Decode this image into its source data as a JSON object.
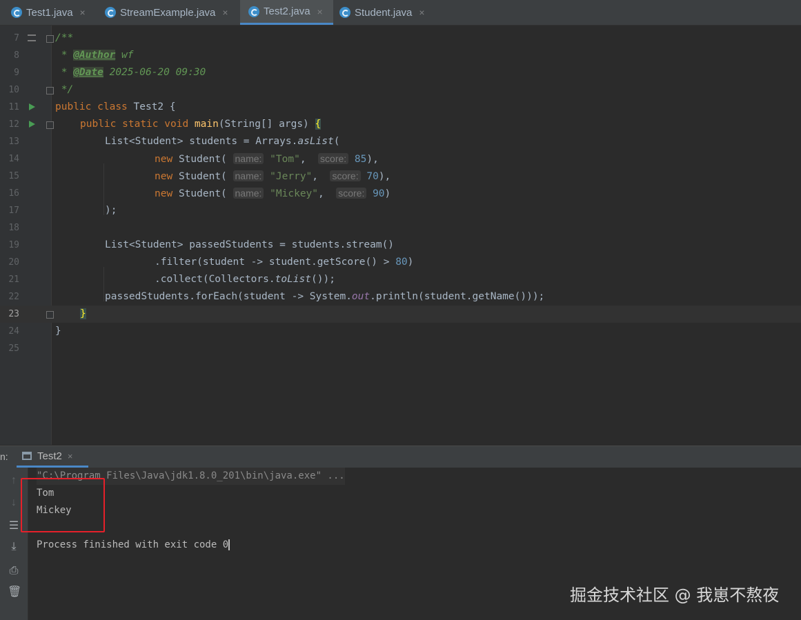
{
  "tabs": [
    {
      "label": "Test1.java",
      "close": "×",
      "active": false
    },
    {
      "label": "StreamExample.java",
      "close": "×",
      "active": false
    },
    {
      "label": "Test2.java",
      "close": "×",
      "active": true
    },
    {
      "label": "Student.java",
      "close": "×",
      "active": false
    }
  ],
  "editor": {
    "line_numbers": [
      "7",
      "8",
      "9",
      "10",
      "11",
      "12",
      "13",
      "14",
      "15",
      "16",
      "17",
      "18",
      "19",
      "20",
      "21",
      "22",
      "23",
      "24",
      "25"
    ],
    "code": {
      "l7": "/**",
      "l8_star": " * ",
      "l8_tag": "@Author",
      "l8_val": " wf",
      "l9_star": " * ",
      "l9_tag": "@Date",
      "l9_val": " 2025-06-20 09:30",
      "l10": " */",
      "kw_public": "public",
      "kw_class": "class",
      "kw_static": "static",
      "kw_void": "void",
      "kw_new": "new",
      "class_name": "Test2",
      "open_brace": "{",
      "close_brace": "}",
      "main": "main",
      "main_args": "(String[] args) ",
      "l13_a": "List<Student> students = Arrays.",
      "as_list": "asList",
      "l13_b": "(",
      "student_ctor": "Student(",
      "hint_name": "name:",
      "hint_score": "score:",
      "students": [
        {
          "name": "\"Tom\"",
          "score": "85",
          "tail": "),"
        },
        {
          "name": "\"Jerry\"",
          "score": "70",
          "tail": "),"
        },
        {
          "name": "\"Mickey\"",
          "score": "90",
          "tail": ")"
        }
      ],
      "comma": ",",
      "l17": ");",
      "l19": "List<Student> passedStudents = students.stream()",
      "l20_a": ".filter(student -> student.getScore() > ",
      "l20_num": "80",
      "l20_b": ")",
      "l21_a": ".collect(Collectors.",
      "to_list": "toList",
      "l21_b": "());",
      "l22_a": "passedStudents.forEach(student -> System.",
      "out": "out",
      "l22_b": ".println(student.getName()));"
    }
  },
  "run_panel": {
    "prefix": "n:",
    "tab_label": "Test2",
    "tab_close": "×",
    "command": "\"C:\\Program Files\\Java\\jdk1.8.0_201\\bin\\java.exe\" ...",
    "output": [
      "Tom",
      "Mickey"
    ],
    "exit_message": "Process finished with exit code 0"
  },
  "watermark": "掘金技术社区 @ 我崽不熬夜",
  "colors": {
    "highlight_box": "#e6202a",
    "accent": "#4a88c7"
  }
}
